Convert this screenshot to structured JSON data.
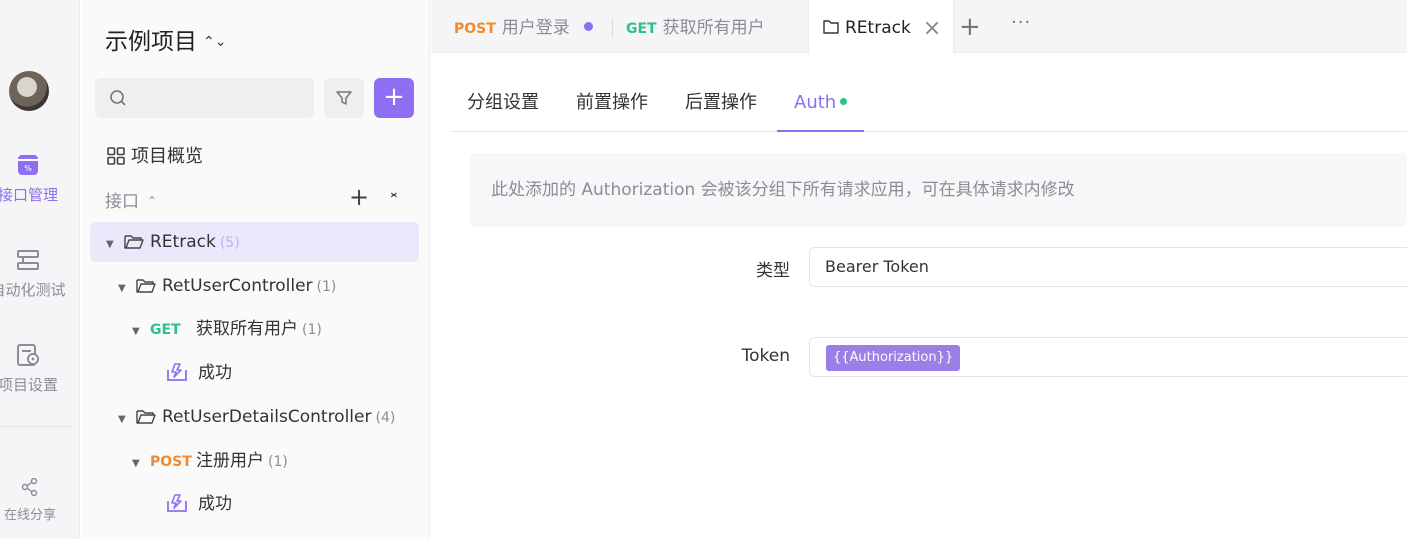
{
  "rail": {
    "items": [
      {
        "label": "接口管理",
        "active": true
      },
      {
        "label": "自动化测试",
        "active": false
      },
      {
        "label": "项目设置",
        "active": false
      }
    ],
    "share": "在线分享"
  },
  "sidebar": {
    "project_title": "示例项目",
    "search_placeholder": "",
    "overview": "项目概览",
    "section_label": "接口",
    "tree": [
      {
        "kind": "folder",
        "label": "REtrack",
        "count": "(5)"
      },
      {
        "kind": "folder",
        "label": "RetUserController",
        "count": "(1)"
      },
      {
        "kind": "api",
        "method": "GET",
        "label": "获取所有用户",
        "count": "(1)"
      },
      {
        "kind": "case",
        "label": "成功"
      },
      {
        "kind": "folder",
        "label": "RetUserDetailsController",
        "count": "(4)"
      },
      {
        "kind": "api",
        "method": "POST",
        "label": "注册用户",
        "count": "(1)"
      },
      {
        "kind": "case",
        "label": "成功"
      }
    ]
  },
  "tabs": [
    {
      "method": "POST",
      "label": "用户登录",
      "modified": true
    },
    {
      "method": "GET",
      "label": "获取所有用户"
    },
    {
      "label": "REtrack",
      "active": true
    }
  ],
  "subtabs": [
    "分组设置",
    "前置操作",
    "后置操作",
    "Auth"
  ],
  "auth": {
    "hint": "此处添加的 Authorization 会被该分组下所有请求应用，可在具体请求内修改",
    "type_label": "类型",
    "type_value": "Bearer Token",
    "token_label": "Token",
    "token_value": "{{Authorization}}"
  },
  "colors": {
    "accent": "#8e6ff2",
    "get": "#2ac08f",
    "post": "#f08a2c"
  }
}
